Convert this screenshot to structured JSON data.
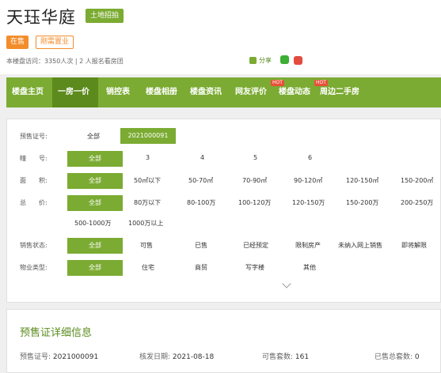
{
  "header": {
    "title": "天珏华庭",
    "land_button": "土地招拍",
    "sale_tag": "在售",
    "type_tag": "刚需置业",
    "stats": "本楼盘访问：3350人次 | 2 人报名看房团",
    "share_label": "分享"
  },
  "nav": {
    "items": [
      "楼盘主页",
      "一房一价",
      "销控表",
      "楼盘相册",
      "楼盘资讯",
      "网友评价",
      "楼盘动态",
      "周边二手房"
    ],
    "hot_badges": [
      "HOT",
      "HOT"
    ]
  },
  "filter": {
    "presale": {
      "label": "预售证号:",
      "all": "全部",
      "selected": "2021000091"
    },
    "building": {
      "label": "幢　　号:",
      "all": "全部",
      "options": [
        "3",
        "4",
        "5",
        "6"
      ]
    },
    "area": {
      "label": "面　　积:",
      "all": "全部",
      "options": [
        "50㎡以下",
        "50-70㎡",
        "70-90㎡",
        "90-120㎡",
        "120-150㎡",
        "150-200㎡"
      ]
    },
    "price": {
      "label": "总　　价:",
      "all": "全部",
      "options": [
        "80万以下",
        "80-100万",
        "100-120万",
        "120-150万",
        "150-200万",
        "200-250万",
        "500-1000万",
        "1000万以上"
      ]
    },
    "sale_status": {
      "label": "销售状态:",
      "all": "全部",
      "options": [
        "可售",
        "已售",
        "已经预定",
        "限制房产",
        "未纳入网上销售",
        "即将解限"
      ]
    },
    "property_type": {
      "label": "物业类型:",
      "all": "全部",
      "options": [
        "住宅",
        "商贸",
        "写字楼",
        "其他"
      ]
    }
  },
  "detail": {
    "title": "预售证详细信息",
    "presale_no_label": "预售证号:",
    "presale_no_value": "2021000091",
    "issue_date_label": "核发日期:",
    "issue_date_value": "2021-08-18",
    "available_label": "可售套数:",
    "available_value": "161",
    "sold_label": "已售总套数:",
    "sold_value": "0"
  }
}
